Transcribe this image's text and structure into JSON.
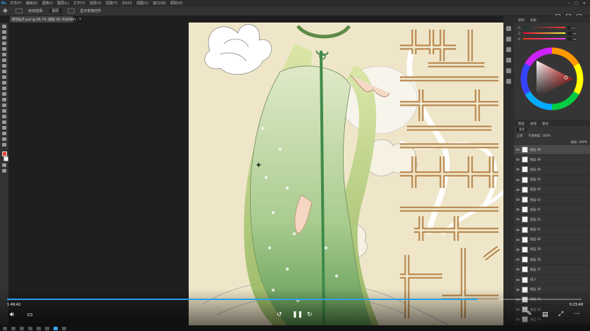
{
  "menubar": {
    "items": [
      "文件(F)",
      "编辑(E)",
      "图像(I)",
      "图层(L)",
      "文字(Y)",
      "选择(S)",
      "滤镜(T)",
      "3D(D)",
      "视图(V)",
      "窗口(W)",
      "帮助(H)"
    ]
  },
  "options_bar": {
    "items": [
      "自动选择:",
      "图层",
      "显示变换控件"
    ]
  },
  "document": {
    "tab_label": "荷花仙子.psd @ 66.7% (图层 49, RGB/8#)"
  },
  "panels": {
    "color_tabs": [
      "颜色",
      "色板"
    ],
    "sliders": [
      {
        "label": "R",
        "value": "237"
      },
      {
        "label": "G",
        "value": "56"
      },
      {
        "label": "B",
        "value": "56"
      }
    ],
    "layers_tabs": [
      "图层",
      "通道",
      "路径"
    ],
    "layer_kind": "类型",
    "blend_mode": "正常",
    "opacity": "不透明度: 100%",
    "fill": "填充: 100%",
    "layers": [
      {
        "name": "图层 49"
      },
      {
        "name": "图层 48"
      },
      {
        "name": "图层 46"
      },
      {
        "name": "图层 45"
      },
      {
        "name": "图层 44"
      },
      {
        "name": "图层 43"
      },
      {
        "name": "图层 47"
      },
      {
        "name": "图层 42"
      },
      {
        "name": "图层 41"
      },
      {
        "name": "图层 40"
      },
      {
        "name": "图层 39"
      },
      {
        "name": "图层 38"
      },
      {
        "name": "图层 37"
      },
      {
        "name": "组 1"
      },
      {
        "name": "图层 36"
      },
      {
        "name": "图层 35"
      },
      {
        "name": "图层 34"
      },
      {
        "name": "图层 33"
      }
    ]
  },
  "video": {
    "elapsed": "1:49:42",
    "duration": "0:23:49",
    "progress": 0.82
  },
  "artwork": {
    "title_chars": [
      "荷",
      "花"
    ]
  },
  "colors": {
    "foreground": "#e8403a",
    "progress": "#2aa0e6",
    "wheel_marker": "#e23a3a"
  }
}
